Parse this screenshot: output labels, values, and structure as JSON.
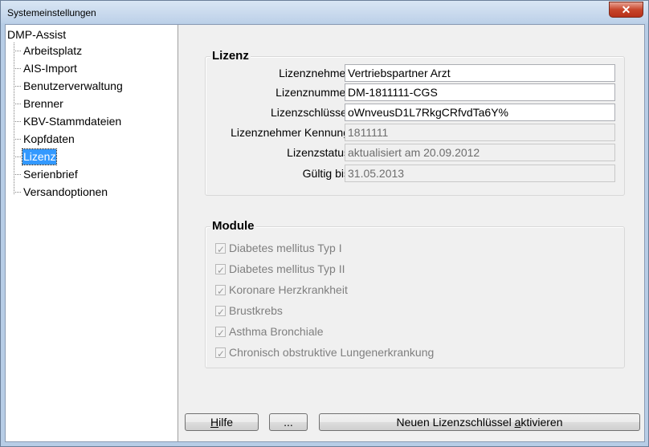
{
  "window": {
    "title": "Systemeinstellungen",
    "close_glyph": "✕"
  },
  "tree": {
    "root": "DMP-Assist",
    "items": [
      {
        "label": "Arbeitsplatz"
      },
      {
        "label": "AIS-Import"
      },
      {
        "label": "Benutzerverwaltung"
      },
      {
        "label": "Brenner"
      },
      {
        "label": "KBV-Stammdateien"
      },
      {
        "label": "Kopfdaten"
      },
      {
        "label": "Lizenz",
        "selected": true
      },
      {
        "label": "Serienbrief"
      },
      {
        "label": "Versandoptionen"
      }
    ]
  },
  "license": {
    "title": "Lizenz",
    "fields": [
      {
        "label": "Lizenznehmer",
        "value": "Vertriebspartner Arzt",
        "readonly": false
      },
      {
        "label": "Lizenznummer",
        "value": "DM-1811111-CGS",
        "readonly": false
      },
      {
        "label": "Lizenzschlüssel",
        "value": "oWnveusD1L7RkgCRfvdTa6Y%",
        "readonly": false
      },
      {
        "label": "Lizenznehmer Kennung",
        "value": "1811111",
        "readonly": true
      },
      {
        "label": "Lizenzstatus",
        "value": "aktualisiert am 20.09.2012",
        "readonly": true
      },
      {
        "label": "Gültig bis",
        "value": "31.05.2013",
        "readonly": true
      }
    ]
  },
  "modules": {
    "title": "Module",
    "items": [
      {
        "label": "Diabetes mellitus Typ I",
        "checked": true,
        "enabled": false
      },
      {
        "label": "Diabetes mellitus Typ II",
        "checked": true,
        "enabled": false
      },
      {
        "label": "Koronare Herzkrankheit",
        "checked": true,
        "enabled": false
      },
      {
        "label": "Brustkrebs",
        "checked": true,
        "enabled": false
      },
      {
        "label": "Asthma Bronchiale",
        "checked": true,
        "enabled": false
      },
      {
        "label": "Chronisch obstruktive Lungenerkrankung",
        "checked": true,
        "enabled": false
      }
    ]
  },
  "buttons": {
    "help_pre": "",
    "help_mnemonic": "H",
    "help_post": "ilfe",
    "ellipsis": "...",
    "activate_pre": "Neuen Lizenzschlüssel ",
    "activate_mnemonic": "a",
    "activate_post": "ktivieren"
  }
}
